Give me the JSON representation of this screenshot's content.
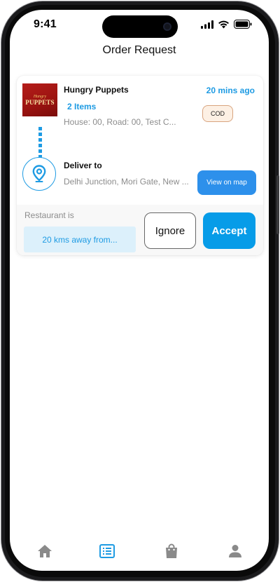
{
  "status_bar": {
    "time": "9:41"
  },
  "header": {
    "title": "Order Request"
  },
  "order": {
    "restaurant": {
      "name": "Hungry Puppets",
      "logo_text_small": "Hungry",
      "logo_text_big": "PUPPETS",
      "address": "House: 00, Road: 00, Test C..."
    },
    "time_ago": "20 mins ago",
    "items_count": "2 Items",
    "payment_badge": "COD",
    "deliver_label": "Deliver to",
    "deliver_address": "Delhi Junction, Mori Gate, New ...",
    "view_map_label": "View on map",
    "restaurant_is_label": "Restaurant is",
    "distance_text": "20 kms away from...",
    "ignore_label": "Ignore",
    "accept_label": "Accept"
  },
  "bottom_nav": {
    "items": [
      {
        "name": "home-icon",
        "active": false
      },
      {
        "name": "list-icon",
        "active": true
      },
      {
        "name": "shopping-bag-icon",
        "active": false
      },
      {
        "name": "profile-icon",
        "active": false
      }
    ]
  },
  "colors": {
    "accent": "#1e9be3",
    "accept": "#079ce8",
    "map_button": "#2d90eb",
    "inactive_icon": "#8a8a8a"
  }
}
